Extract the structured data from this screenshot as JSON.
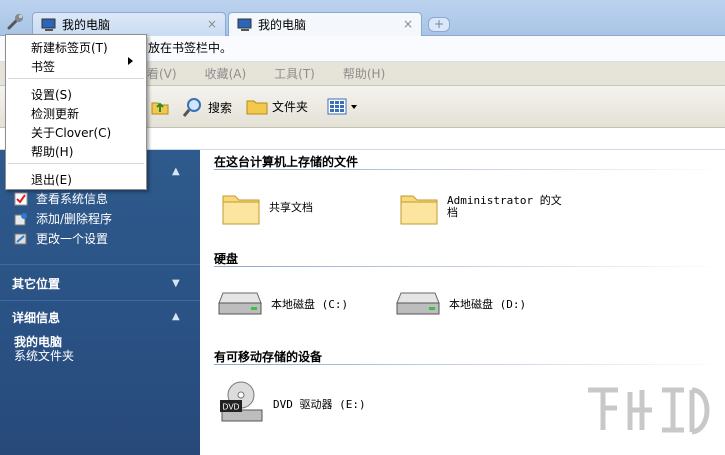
{
  "tabs": [
    {
      "label": "我的电脑",
      "close": "×"
    },
    {
      "label": "我的电脑",
      "close": "×"
    }
  ],
  "new_tab": "+",
  "bookmark_hint": "放在书签栏中。",
  "menubar": {
    "items": [
      "看(V)",
      "收藏(A)",
      "工具(T)",
      "帮助(H)"
    ]
  },
  "toolbar": {
    "search": "搜索",
    "folders": "文件夹"
  },
  "app_menu": {
    "items": [
      "新建标签页(T)",
      "书签",
      "设置(S)",
      "检测更新",
      "关于Clover(C)",
      "帮助(H)",
      "退出(E)"
    ]
  },
  "left_pane": {
    "tasks": [
      "查看系统信息",
      "添加/删除程序",
      "更改一个设置"
    ],
    "other_places": "其它位置",
    "details_title": "详细信息",
    "details_name": "我的电脑",
    "details_sub": "系统文件夹"
  },
  "main": {
    "group_files": "在这台计算机上存储的文件",
    "shared_docs": "共享文档",
    "admin_docs": "Administrator 的文档",
    "group_drives": "硬盘",
    "drive_c": "本地磁盘 (C:)",
    "drive_d": "本地磁盘 (D:)",
    "group_removable": "有可移动存储的设备",
    "dvd": "DVD 驱动器 (E:)",
    "dvd_badge": "DVD"
  },
  "colors": {
    "left_pane": "#2a5184",
    "tabstrip": "#bcd3ef",
    "menubar": "#e6e3d8"
  }
}
